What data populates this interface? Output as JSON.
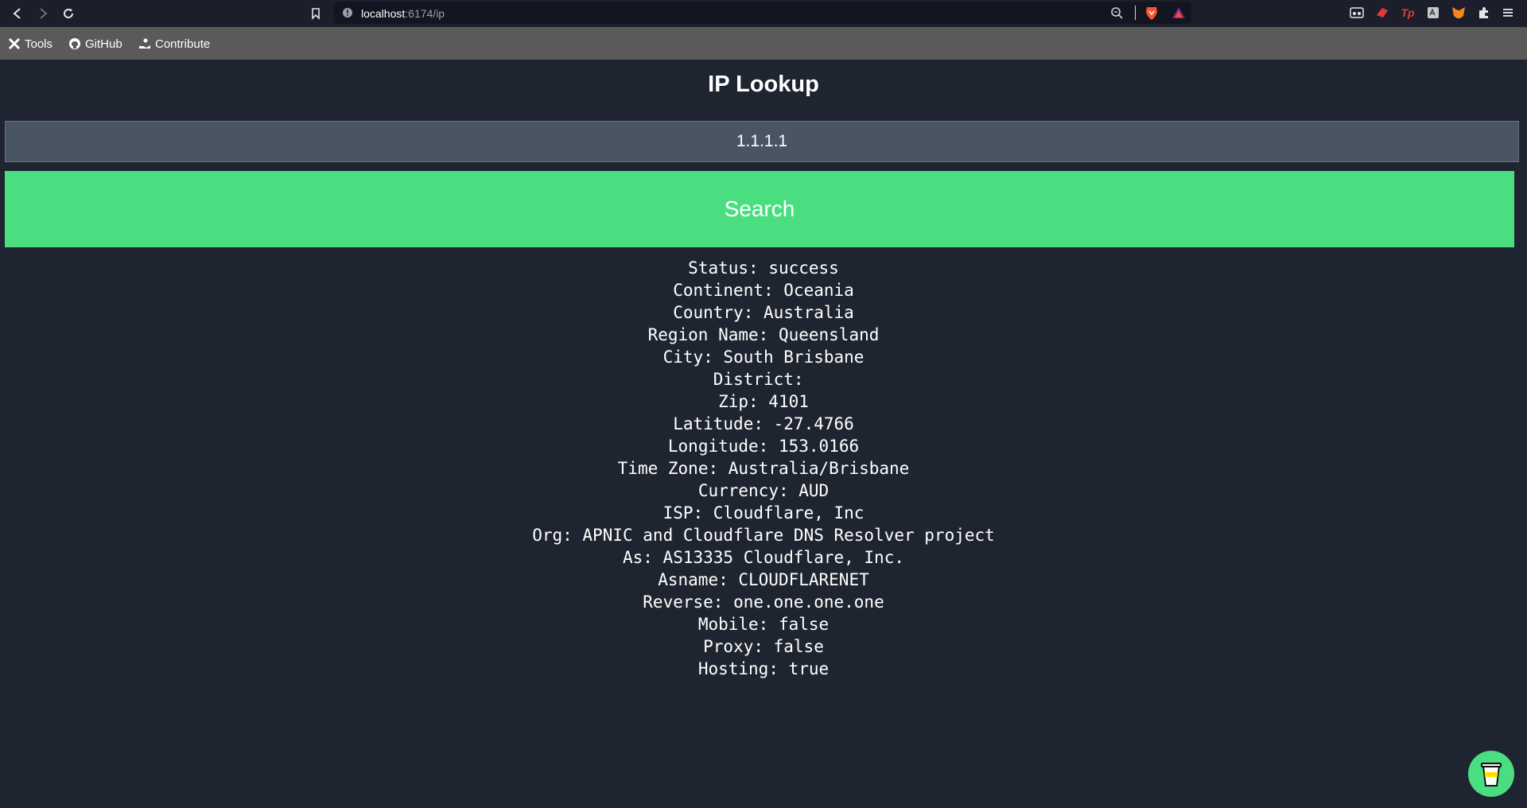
{
  "browser": {
    "url_host": "localhost",
    "url_path": ":6174/ip"
  },
  "bookmarks": [
    {
      "label": "Tools"
    },
    {
      "label": "GitHub"
    },
    {
      "label": "Contribute"
    }
  ],
  "page": {
    "title": "IP Lookup",
    "input_value": "1.1.1.1",
    "search_label": "Search"
  },
  "results": [
    "Status: success",
    "Continent: Oceania",
    "Country: Australia",
    "Region Name: Queensland",
    "City: South Brisbane",
    "District: ",
    "Zip: 4101",
    "Latitude: -27.4766",
    "Longitude: 153.0166",
    "Time Zone: Australia/Brisbane",
    "Currency: AUD",
    "ISP: Cloudflare, Inc",
    "Org: APNIC and Cloudflare DNS Resolver project",
    "As: AS13335 Cloudflare, Inc.",
    "Asname: CLOUDFLARENET",
    "Reverse: one.one.one.one",
    "Mobile: false",
    "Proxy: false",
    "Hosting: true"
  ],
  "colors": {
    "page_bg": "#1f2530",
    "accent": "#4ade80",
    "input_bg": "#4a5563",
    "bookmarks_bg": "#5a5a5a"
  }
}
